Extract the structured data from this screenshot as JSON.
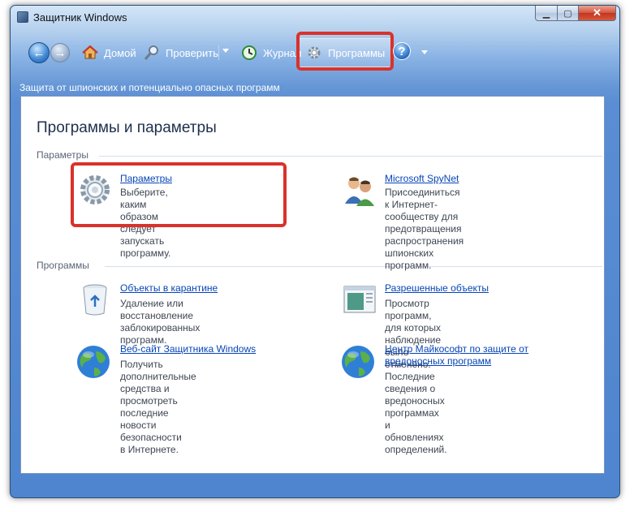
{
  "window": {
    "title": "Защитник Windows"
  },
  "toolbar": {
    "home_label": "Домой",
    "scan_label": "Проверить",
    "history_label": "Журнал",
    "programs_label": "Программы",
    "help_label": "?"
  },
  "subheader": "Защита от шпионских  и потенциально опасных программ",
  "panel": {
    "title": "Программы и параметры",
    "groups": [
      {
        "label": "Параметры",
        "items": [
          {
            "icon": "gear-icon",
            "link": "Параметры",
            "desc": [
              "Выберите, каким образом следует",
              "запускать программу."
            ]
          },
          {
            "icon": "users-icon",
            "link": "Microsoft SpyNet",
            "desc": [
              "Присоединиться к Интернет-сообществу для",
              "предотвращения распространения",
              "шпионских программ."
            ]
          }
        ]
      },
      {
        "label": "Программы",
        "items": [
          {
            "icon": "recycle-bin-icon",
            "link": "Объекты в карантине",
            "desc": [
              "Удаление или восстановление",
              "заблокированных программ."
            ]
          },
          {
            "icon": "window-list-icon",
            "link": "Разрешенные объекты",
            "desc": [
              "Просмотр программ, для которых",
              "наблюдение было отменено."
            ]
          },
          {
            "icon": "globe-icon",
            "link": "Веб-сайт Защитника Windows",
            "desc": [
              "Получить дополнительные",
              "средства и просмотреть",
              "последние новости безопасности",
              "в Интернете."
            ]
          },
          {
            "icon": "globe-icon",
            "link": [
              "Центр Майкософт по защите от",
              "вредоносных программ"
            ],
            "desc": [
              "Последние сведения о вредоносных",
              "программах и обновлениях определений."
            ]
          }
        ]
      }
    ]
  },
  "colors": {
    "highlight": "#d9322b",
    "link": "#0645b7",
    "accent": "#4f85cf"
  }
}
